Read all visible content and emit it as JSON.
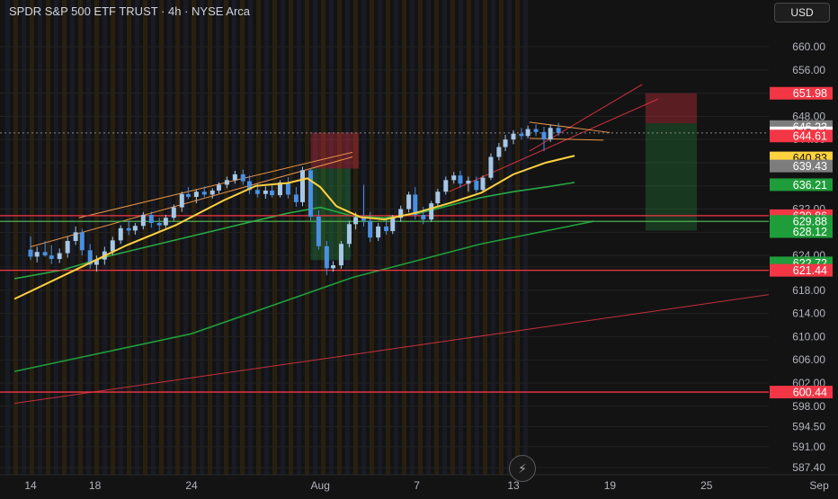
{
  "header": {
    "title": "SPDR S&P 500 ETF TRUST · 4h · NYSE Arca",
    "currency": "USD"
  },
  "toolbar": {
    "bolt_icon": "lightning-icon"
  },
  "colors": {
    "background": "#131313",
    "up": "#a7c7e7",
    "down": "#4a90e2",
    "ma_fast": "#ffd23f",
    "ma_slow": "#27a844",
    "ma_long": "#1f9d3a",
    "red_line": "#f23645",
    "green_line": "#4caf50",
    "channel": "#e89449"
  },
  "chart_data": {
    "type": "candlestick",
    "title": "SPDR S&P 500 ETF TRUST · 4h · NYSE Arca",
    "ylim": [
      586.5,
      665.5
    ],
    "y_ticks": [
      "660.00",
      "656.00",
      "652.00",
      "648.00",
      "644.00",
      "640.00",
      "636.00",
      "632.00",
      "628.00",
      "624.00",
      "622.00",
      "618.00",
      "614.00",
      "610.00",
      "606.00",
      "602.00",
      "598.00",
      "594.50",
      "591.00",
      "587.40"
    ],
    "x_ticks": [
      {
        "label": "14",
        "day": 0
      },
      {
        "label": "18",
        "day": 4
      },
      {
        "label": "24",
        "day": 10
      },
      {
        "label": "Aug",
        "day": 18
      },
      {
        "label": "7",
        "day": 24
      },
      {
        "label": "13",
        "day": 30
      },
      {
        "label": "19",
        "day": 36
      },
      {
        "label": "25",
        "day": 42
      },
      {
        "label": "Sep",
        "day": 49
      }
    ],
    "horizontal_levels": [
      {
        "price": 630.86,
        "color": "#f23645"
      },
      {
        "price": 629.88,
        "color": "#4caf50"
      },
      {
        "price": 621.44,
        "color": "#f23645"
      },
      {
        "price": 600.44,
        "color": "#f23645"
      }
    ],
    "price_labels": [
      {
        "price": 651.98,
        "text": "651.98",
        "bg": "#f23645",
        "fg": "#ffffff"
      },
      {
        "price": 646.23,
        "text": "646.23",
        "bg": "#7d7d7d",
        "fg": "#ffffff"
      },
      {
        "price": 645.14,
        "text": "645.14",
        "bg": "#ffffff",
        "fg": "#131313"
      },
      {
        "price": 644.61,
        "text": "644.61",
        "bg": "#f23645",
        "fg": "#ffffff"
      },
      {
        "price": 640.83,
        "text": "640.83",
        "bg": "#ffd23f",
        "fg": "#131313"
      },
      {
        "price": 639.43,
        "text": "639.43",
        "bg": "#7d7d7d",
        "fg": "#ffffff"
      },
      {
        "price": 636.21,
        "text": "636.21",
        "bg": "#1f9d3a",
        "fg": "#ffffff"
      },
      {
        "price": 630.86,
        "text": "630.86",
        "bg": "#f23645",
        "fg": "#ffffff"
      },
      {
        "price": 629.88,
        "text": "629.88",
        "bg": "#1f9d3a",
        "fg": "#ffffff"
      },
      {
        "price": 628.12,
        "text": "628.12",
        "bg": "#1f9d3a",
        "fg": "#ffffff"
      },
      {
        "price": 622.72,
        "text": "622.72",
        "bg": "#1f9d3a",
        "fg": "#ffffff"
      },
      {
        "price": 621.44,
        "text": "621.44",
        "bg": "#f23645",
        "fg": "#ffffff"
      },
      {
        "price": 600.44,
        "text": "600.44",
        "bg": "#f23645",
        "fg": "#ffffff"
      }
    ],
    "candles": [
      {
        "day": 0.0,
        "o": 625.0,
        "h": 627.3,
        "l": 623.2,
        "c": 623.8
      },
      {
        "day": 0.4,
        "o": 623.8,
        "h": 625.5,
        "l": 622.8,
        "c": 624.6
      },
      {
        "day": 0.9,
        "o": 624.6,
        "h": 626.5,
        "l": 623.8,
        "c": 624.0
      },
      {
        "day": 1.3,
        "o": 624.0,
        "h": 625.8,
        "l": 622.5,
        "c": 623.4
      },
      {
        "day": 1.8,
        "o": 623.4,
        "h": 625.2,
        "l": 622.7,
        "c": 624.4
      },
      {
        "day": 2.3,
        "o": 624.4,
        "h": 627.2,
        "l": 623.6,
        "c": 626.5
      },
      {
        "day": 2.8,
        "o": 626.5,
        "h": 629.0,
        "l": 625.8,
        "c": 628.0
      },
      {
        "day": 3.2,
        "o": 628.0,
        "h": 628.6,
        "l": 624.0,
        "c": 624.9
      },
      {
        "day": 3.7,
        "o": 624.9,
        "h": 626.0,
        "l": 621.7,
        "c": 622.4
      },
      {
        "day": 4.1,
        "o": 622.4,
        "h": 624.0,
        "l": 621.2,
        "c": 623.3
      },
      {
        "day": 4.6,
        "o": 623.3,
        "h": 625.5,
        "l": 622.4,
        "c": 624.7
      },
      {
        "day": 5.1,
        "o": 624.7,
        "h": 627.2,
        "l": 624.0,
        "c": 626.6
      },
      {
        "day": 5.6,
        "o": 626.6,
        "h": 629.2,
        "l": 626.0,
        "c": 628.7
      },
      {
        "day": 6.1,
        "o": 628.7,
        "h": 630.0,
        "l": 627.5,
        "c": 628.3
      },
      {
        "day": 6.5,
        "o": 628.3,
        "h": 629.6,
        "l": 627.6,
        "c": 629.1
      },
      {
        "day": 7.0,
        "o": 629.1,
        "h": 631.5,
        "l": 628.5,
        "c": 631.0
      },
      {
        "day": 7.5,
        "o": 631.0,
        "h": 631.6,
        "l": 628.8,
        "c": 629.6
      },
      {
        "day": 8.0,
        "o": 629.6,
        "h": 630.5,
        "l": 628.0,
        "c": 629.2
      },
      {
        "day": 8.4,
        "o": 629.2,
        "h": 631.0,
        "l": 628.7,
        "c": 630.5
      },
      {
        "day": 8.9,
        "o": 630.5,
        "h": 632.8,
        "l": 630.0,
        "c": 632.3
      },
      {
        "day": 9.4,
        "o": 632.3,
        "h": 635.0,
        "l": 631.5,
        "c": 634.6
      },
      {
        "day": 9.8,
        "o": 634.6,
        "h": 635.8,
        "l": 633.7,
        "c": 634.1
      },
      {
        "day": 10.3,
        "o": 634.1,
        "h": 635.4,
        "l": 633.0,
        "c": 635.0
      },
      {
        "day": 10.8,
        "o": 635.0,
        "h": 635.9,
        "l": 634.0,
        "c": 634.5
      },
      {
        "day": 11.3,
        "o": 634.5,
        "h": 635.6,
        "l": 633.8,
        "c": 635.2
      },
      {
        "day": 11.7,
        "o": 635.2,
        "h": 636.6,
        "l": 634.7,
        "c": 636.2
      },
      {
        "day": 12.2,
        "o": 636.2,
        "h": 637.6,
        "l": 635.6,
        "c": 637.0
      },
      {
        "day": 12.7,
        "o": 637.0,
        "h": 638.6,
        "l": 636.4,
        "c": 638.0
      },
      {
        "day": 13.2,
        "o": 638.0,
        "h": 638.8,
        "l": 636.2,
        "c": 636.8
      },
      {
        "day": 13.6,
        "o": 636.8,
        "h": 637.8,
        "l": 634.6,
        "c": 635.3
      },
      {
        "day": 14.1,
        "o": 635.3,
        "h": 636.4,
        "l": 634.0,
        "c": 634.6
      },
      {
        "day": 14.6,
        "o": 634.6,
        "h": 635.9,
        "l": 633.8,
        "c": 635.2
      },
      {
        "day": 15.0,
        "o": 635.2,
        "h": 636.2,
        "l": 634.0,
        "c": 634.4
      },
      {
        "day": 15.5,
        "o": 634.4,
        "h": 637.0,
        "l": 634.0,
        "c": 636.6
      },
      {
        "day": 16.0,
        "o": 636.6,
        "h": 637.5,
        "l": 633.8,
        "c": 634.5
      },
      {
        "day": 16.5,
        "o": 634.5,
        "h": 635.8,
        "l": 632.4,
        "c": 633.2
      },
      {
        "day": 16.9,
        "o": 633.2,
        "h": 639.3,
        "l": 632.5,
        "c": 638.7
      },
      {
        "day": 17.4,
        "o": 638.7,
        "h": 639.0,
        "l": 630.0,
        "c": 630.7
      },
      {
        "day": 17.9,
        "o": 630.7,
        "h": 631.8,
        "l": 625.0,
        "c": 625.6
      },
      {
        "day": 18.4,
        "o": 625.6,
        "h": 626.5,
        "l": 620.6,
        "c": 621.8
      },
      {
        "day": 18.8,
        "o": 621.8,
        "h": 623.0,
        "l": 621.2,
        "c": 622.3
      },
      {
        "day": 19.3,
        "o": 622.3,
        "h": 626.5,
        "l": 621.7,
        "c": 626.0
      },
      {
        "day": 19.8,
        "o": 626.0,
        "h": 630.0,
        "l": 625.4,
        "c": 629.4
      },
      {
        "day": 20.2,
        "o": 629.4,
        "h": 631.4,
        "l": 628.5,
        "c": 630.6
      },
      {
        "day": 20.7,
        "o": 630.6,
        "h": 636.2,
        "l": 629.0,
        "c": 630.0
      },
      {
        "day": 21.1,
        "o": 630.0,
        "h": 631.5,
        "l": 626.3,
        "c": 627.1
      },
      {
        "day": 21.6,
        "o": 627.1,
        "h": 629.6,
        "l": 626.5,
        "c": 629.0
      },
      {
        "day": 22.1,
        "o": 629.0,
        "h": 630.2,
        "l": 627.6,
        "c": 628.2
      },
      {
        "day": 22.5,
        "o": 628.2,
        "h": 631.0,
        "l": 627.7,
        "c": 630.5
      },
      {
        "day": 23.0,
        "o": 630.5,
        "h": 632.6,
        "l": 629.8,
        "c": 632.0
      },
      {
        "day": 23.5,
        "o": 632.0,
        "h": 635.0,
        "l": 631.4,
        "c": 634.5
      },
      {
        "day": 23.9,
        "o": 634.5,
        "h": 635.8,
        "l": 630.2,
        "c": 631.0
      },
      {
        "day": 24.4,
        "o": 631.0,
        "h": 632.4,
        "l": 629.4,
        "c": 630.2
      },
      {
        "day": 24.9,
        "o": 630.2,
        "h": 633.4,
        "l": 629.8,
        "c": 633.0
      },
      {
        "day": 25.3,
        "o": 633.0,
        "h": 635.5,
        "l": 632.4,
        "c": 635.0
      },
      {
        "day": 25.8,
        "o": 635.0,
        "h": 637.6,
        "l": 634.5,
        "c": 637.0
      },
      {
        "day": 26.3,
        "o": 637.0,
        "h": 638.4,
        "l": 636.4,
        "c": 637.8
      },
      {
        "day": 26.7,
        "o": 637.8,
        "h": 638.6,
        "l": 635.7,
        "c": 636.4
      },
      {
        "day": 27.2,
        "o": 636.4,
        "h": 637.6,
        "l": 635.0,
        "c": 636.9
      },
      {
        "day": 27.7,
        "o": 636.9,
        "h": 637.6,
        "l": 634.8,
        "c": 635.3
      },
      {
        "day": 28.1,
        "o": 635.3,
        "h": 637.8,
        "l": 634.8,
        "c": 637.4
      },
      {
        "day": 28.6,
        "o": 637.4,
        "h": 641.6,
        "l": 637.0,
        "c": 641.0
      },
      {
        "day": 29.1,
        "o": 641.0,
        "h": 643.4,
        "l": 640.4,
        "c": 642.7
      },
      {
        "day": 29.5,
        "o": 642.7,
        "h": 644.8,
        "l": 642.0,
        "c": 644.0
      },
      {
        "day": 30.0,
        "o": 644.0,
        "h": 645.6,
        "l": 643.2,
        "c": 645.0
      },
      {
        "day": 30.5,
        "o": 645.0,
        "h": 646.0,
        "l": 644.0,
        "c": 644.6
      },
      {
        "day": 30.9,
        "o": 644.6,
        "h": 646.4,
        "l": 644.2,
        "c": 645.8
      },
      {
        "day": 31.4,
        "o": 645.8,
        "h": 646.6,
        "l": 644.6,
        "c": 645.3
      },
      {
        "day": 31.9,
        "o": 645.3,
        "h": 646.2,
        "l": 642.0,
        "c": 644.0
      },
      {
        "day": 32.3,
        "o": 644.0,
        "h": 646.6,
        "l": 643.6,
        "c": 646.0
      },
      {
        "day": 32.8,
        "o": 646.0,
        "h": 646.9,
        "l": 644.6,
        "c": 645.14
      }
    ],
    "ma_fast": [
      [
        -1,
        616.5
      ],
      [
        3,
        621.8
      ],
      [
        6,
        625.8
      ],
      [
        9,
        629.2
      ],
      [
        12,
        633.5
      ],
      [
        14,
        636.0
      ],
      [
        16,
        636.5
      ],
      [
        17.2,
        637.3
      ],
      [
        18.0,
        635.8
      ],
      [
        19.0,
        632.5
      ],
      [
        20.5,
        630.6
      ],
      [
        22,
        630.2
      ],
      [
        24,
        631.4
      ],
      [
        26,
        633.0
      ],
      [
        28,
        634.8
      ],
      [
        30,
        638.0
      ],
      [
        32,
        640.0
      ],
      [
        33.8,
        641.2
      ]
    ],
    "ma_slow": [
      [
        -1,
        620.0
      ],
      [
        2,
        621.5
      ],
      [
        5,
        624.0
      ],
      [
        8,
        626.0
      ],
      [
        11,
        628.0
      ],
      [
        14,
        630.0
      ],
      [
        16,
        631.3
      ],
      [
        18,
        632.3
      ],
      [
        20,
        630.8
      ],
      [
        22,
        630.5
      ],
      [
        24,
        631.2
      ],
      [
        26,
        632.6
      ],
      [
        28,
        634.0
      ],
      [
        30,
        635.0
      ],
      [
        32,
        635.8
      ],
      [
        33.8,
        636.6
      ]
    ],
    "ma_long": [
      [
        -1,
        604.0
      ],
      [
        10,
        610.5
      ],
      [
        20,
        620.2
      ],
      [
        28,
        626.0
      ],
      [
        35,
        629.9
      ]
    ],
    "trend_red_long": [
      [
        -1,
        598.5
      ],
      [
        49,
        618.5
      ]
    ],
    "channel_lower": [
      [
        0,
        625.5
      ],
      [
        20,
        641.0
      ]
    ],
    "channel_upper_short": [
      [
        3,
        630.5
      ],
      [
        20,
        641.8
      ]
    ],
    "wedge_top": [
      [
        31,
        647.0
      ],
      [
        36,
        645.2
      ]
    ],
    "wedge_bot": [
      [
        31,
        644.2
      ],
      [
        35.6,
        643.9
      ]
    ],
    "channel_red_upper": [
      [
        31,
        642.0
      ],
      [
        38,
        653.5
      ]
    ],
    "channel_red_lower": [
      [
        26,
        635.0
      ],
      [
        39,
        651.0
      ]
    ],
    "zones": [
      {
        "x0": 17.4,
        "x1": 20.4,
        "y0": 639.0,
        "y1": 645.2,
        "color": "#f23645",
        "opacity": 0.32
      },
      {
        "x0": 17.4,
        "x1": 19.9,
        "y0": 623.2,
        "y1": 639.0,
        "color": "#27a844",
        "opacity": 0.28
      },
      {
        "x0": 38.2,
        "x1": 41.4,
        "y0": 646.8,
        "y1": 651.98,
        "color": "#f23645",
        "opacity": 0.32
      },
      {
        "x0": 38.2,
        "x1": 41.4,
        "y0": 628.3,
        "y1": 646.8,
        "color": "#27a844",
        "opacity": 0.25
      }
    ]
  }
}
